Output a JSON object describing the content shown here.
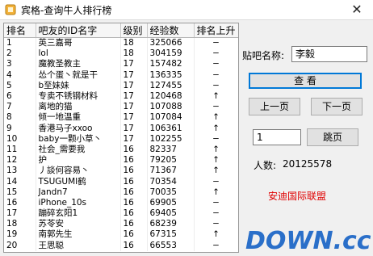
{
  "window": {
    "title": "宾格-查询牛人排行榜",
    "close_glyph": "✕"
  },
  "table": {
    "headers": [
      "排名",
      "吧友的ID名字",
      "级别",
      "经验数",
      "排名上升"
    ],
    "rows": [
      [
        "1",
        "英三嘉哥",
        "18",
        "325066",
        "−"
      ],
      [
        "2",
        "lol",
        "18",
        "304159",
        "−"
      ],
      [
        "3",
        "魔教圣教主",
        "17",
        "157482",
        "−"
      ],
      [
        "4",
        "怂个蛋丶就是干",
        "17",
        "136335",
        "−"
      ],
      [
        "5",
        "b至妹妹",
        "17",
        "127455",
        "−"
      ],
      [
        "6",
        "专卖不锈钢材料",
        "17",
        "120468",
        "↑"
      ],
      [
        "7",
        "离地的猫",
        "17",
        "107088",
        "−"
      ],
      [
        "8",
        "倾一地温重",
        "17",
        "107084",
        "↑"
      ],
      [
        "9",
        "香港马子xxoo",
        "17",
        "106361",
        "↑"
      ],
      [
        "10",
        "baby一颗小草丶",
        "17",
        "102255",
        "−"
      ],
      [
        "11",
        "社会_需要我",
        "16",
        "82337",
        "↑"
      ],
      [
        "12",
        "护",
        "16",
        "79205",
        "↑"
      ],
      [
        "13",
        "丿談何容易丶",
        "16",
        "71367",
        "↑"
      ],
      [
        "14",
        "TSUGUMI鹤",
        "16",
        "70354",
        "−"
      ],
      [
        "15",
        "Jandn7",
        "16",
        "70035",
        "↑"
      ],
      [
        "16",
        "iPhone_10s",
        "16",
        "69905",
        "−"
      ],
      [
        "17",
        "蹦碎玄阳1",
        "16",
        "69405",
        "−"
      ],
      [
        "18",
        "苏苓安",
        "16",
        "68239",
        "−"
      ],
      [
        "19",
        "南郭先生",
        "16",
        "67315",
        "↑"
      ],
      [
        "20",
        "王思聪",
        "16",
        "66553",
        "−"
      ]
    ]
  },
  "panel": {
    "bar_name_label": "贴吧名称:",
    "bar_name_value": "李毅",
    "view_button": "查    看",
    "prev_page_button": "上一页",
    "next_page_button": "下一页",
    "page_number": "1",
    "jump_button": "跳页",
    "population_label": "人数:",
    "population_value": "20125578",
    "alliance_link": "安迪国际联盟"
  },
  "watermark": {
    "text": "DOWN.cc"
  }
}
